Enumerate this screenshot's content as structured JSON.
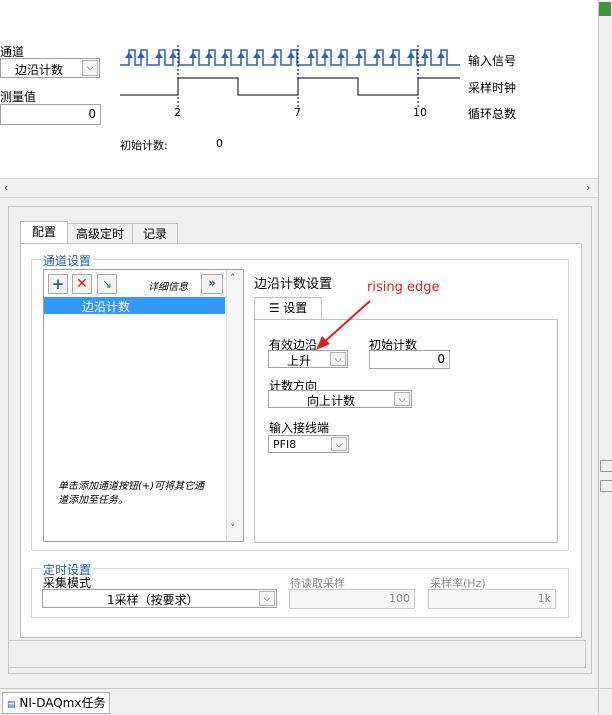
{
  "top": {
    "channel_label": "通道",
    "channel_value": "边沿计数",
    "measured_label": "测量值",
    "measured_value": "0",
    "signal_labels": [
      "输入信号",
      "采样时钟",
      "循环总数"
    ],
    "tick_values": [
      "2",
      "7",
      "10"
    ],
    "initial_count_label": "初始计数:",
    "initial_count_value": "0"
  },
  "tabs": [
    "配置",
    "高级定时",
    "记录"
  ],
  "channel_settings": {
    "title": "通道设置",
    "details_label": "详细信息",
    "details_button": "»",
    "channels": [
      "边沿计数"
    ],
    "hint": "单击添加通道按钮(+)可将其它通道添加至任务。"
  },
  "edge_settings": {
    "title": "边沿计数设置",
    "settings_tab": "设置",
    "active_edge_label": "有效边沿",
    "active_edge_value": "上升",
    "initial_count_label": "初始计数",
    "initial_count_value": "0",
    "count_direction_label": "计数方向",
    "count_direction_value": "向上计数",
    "input_terminal_label": "输入接线端",
    "input_terminal_value": "PFI8",
    "annotation": "rising edge"
  },
  "timing": {
    "title": "定时设置",
    "mode_label": "采集模式",
    "mode_value": "1采样（按要求）",
    "samples_label": "待读取采样",
    "samples_value": "100",
    "rate_label": "采样率(Hz)",
    "rate_value": "1k"
  },
  "bottom_tab": "NI-DAQmx任务",
  "colors": {
    "signal_blue": "#2a5fc9",
    "title_blue": "#1f5fb0",
    "annotation_red": "#e02020",
    "selection_blue": "#3399ff"
  }
}
